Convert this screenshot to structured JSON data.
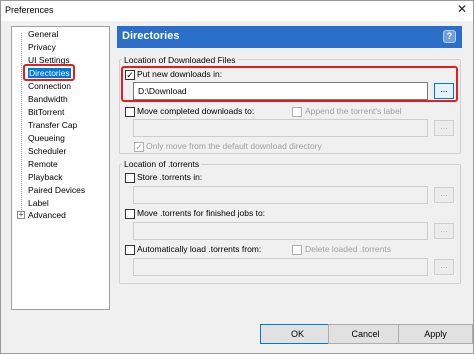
{
  "window": {
    "title": "Preferences",
    "close_glyph": "✕"
  },
  "sidebar": {
    "items": [
      {
        "label": "General"
      },
      {
        "label": "Privacy"
      },
      {
        "label": "UI Settings"
      },
      {
        "label": "Directories"
      },
      {
        "label": "Connection"
      },
      {
        "label": "Bandwidth"
      },
      {
        "label": "BitTorrent"
      },
      {
        "label": "Transfer Cap"
      },
      {
        "label": "Queueing"
      },
      {
        "label": "Scheduler"
      },
      {
        "label": "Remote"
      },
      {
        "label": "Playback"
      },
      {
        "label": "Paired Devices"
      },
      {
        "label": "Label"
      },
      {
        "label": "Advanced"
      }
    ],
    "selected": "Directories",
    "expander_glyph": "+"
  },
  "panel": {
    "title": "Directories",
    "help_glyph": "?"
  },
  "downloaded": {
    "group_title": "Location of Downloaded Files",
    "put_new_label": "Put new downloads in:",
    "put_new_checked": true,
    "put_new_path": "D:\\Download",
    "move_completed_label": "Move completed downloads to:",
    "move_completed_checked": false,
    "append_label_text": "Append the torrent's label",
    "append_label_checked": false,
    "move_completed_path": "",
    "only_move_label": "Only move from the default download directory",
    "only_move_checked": true
  },
  "torrents": {
    "group_title": "Location of .torrents",
    "store_label": "Store .torrents in:",
    "store_checked": false,
    "store_path": "",
    "move_finished_label": "Move .torrents for finished jobs to:",
    "move_finished_checked": false,
    "move_finished_path": "",
    "auto_load_label": "Automatically load .torrents from:",
    "auto_load_checked": false,
    "delete_loaded_label": "Delete loaded .torrents",
    "delete_loaded_checked": false,
    "auto_load_path": ""
  },
  "browse_label": "...",
  "check_glyph": "✓",
  "footer": {
    "ok": "OK",
    "cancel": "Cancel",
    "apply": "Apply"
  }
}
